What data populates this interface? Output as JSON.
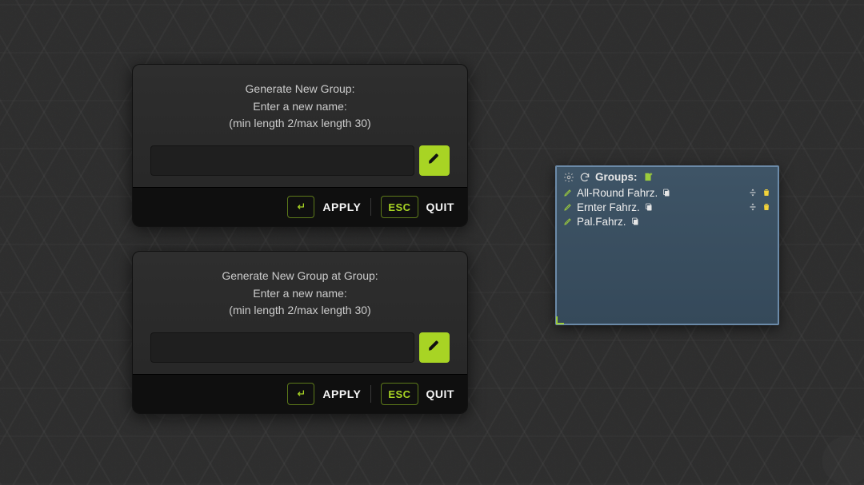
{
  "dialog1": {
    "title": "Generate New Group:",
    "prompt": "Enter a new name:",
    "constraint": "(min length 2/max length 30)",
    "input_value": "",
    "input_placeholder": "",
    "apply_key": "enter",
    "apply_label": "APPLY",
    "quit_key": "ESC",
    "quit_label": "QUIT"
  },
  "dialog2": {
    "title": "Generate New Group at Group:",
    "prompt": "Enter a new name:",
    "constraint": "(min length 2/max length 30)",
    "input_value": "",
    "input_placeholder": "",
    "apply_key": "enter",
    "apply_label": "APPLY",
    "quit_key": "ESC",
    "quit_label": "QUIT"
  },
  "groups_panel": {
    "title": "Groups:",
    "rows": [
      {
        "name": "All-Round Fahrz."
      },
      {
        "name": "Ernter Fahrz."
      },
      {
        "name": "Pal.Fahrz."
      }
    ]
  }
}
